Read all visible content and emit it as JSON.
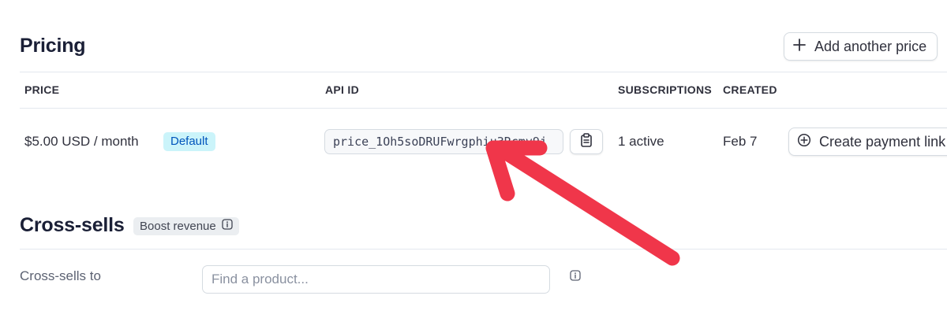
{
  "pricing": {
    "title": "Pricing",
    "add_price_label": "Add another price",
    "columns": {
      "price": "PRICE",
      "api_id": "API ID",
      "subscriptions": "SUBSCRIPTIONS",
      "created": "CREATED"
    },
    "rows": [
      {
        "price": "$5.00 USD / month",
        "badge": "Default",
        "api_id": "price_1Oh5soDRUFwrgphiu3Rcmv9j",
        "subscriptions": "1 active",
        "created": "Feb 7",
        "action_label": "Create payment link"
      }
    ]
  },
  "cross_sells": {
    "title": "Cross-sells",
    "badge": "Boost revenue",
    "field_label": "Cross-sells to",
    "search_placeholder": "Find a product..."
  },
  "annotation": {
    "arrow_color": "#f0364a"
  },
  "colors": {
    "default_badge_bg": "#cbf4fa",
    "default_badge_text": "#0055bc",
    "divider": "#e3e8ee"
  }
}
